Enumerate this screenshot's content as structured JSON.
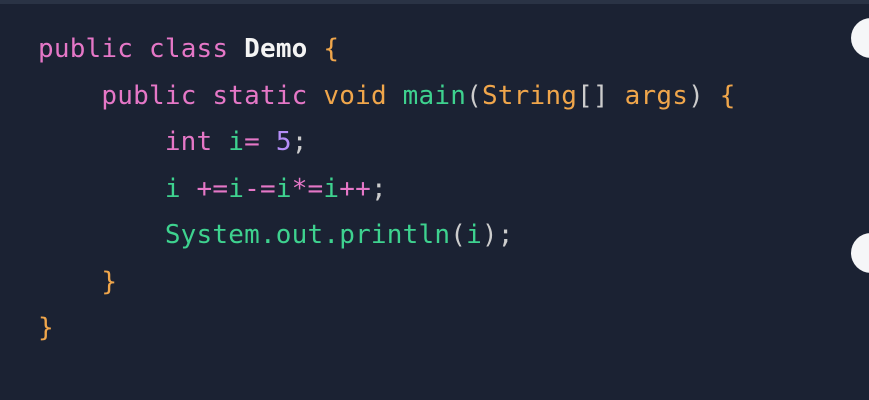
{
  "code": {
    "lines": [
      {
        "tokens": [
          {
            "text": "public",
            "kind": "keyword"
          },
          {
            "text": " ",
            "kind": "space"
          },
          {
            "text": "class",
            "kind": "keyword"
          },
          {
            "text": " ",
            "kind": "space"
          },
          {
            "text": "Demo",
            "kind": "classname"
          },
          {
            "text": " ",
            "kind": "space"
          },
          {
            "text": "{",
            "kind": "brace"
          }
        ]
      },
      {
        "tokens": [
          {
            "text": "    ",
            "kind": "space"
          },
          {
            "text": "public",
            "kind": "keyword"
          },
          {
            "text": " ",
            "kind": "space"
          },
          {
            "text": "static",
            "kind": "keyword"
          },
          {
            "text": " ",
            "kind": "space"
          },
          {
            "text": "void",
            "kind": "type"
          },
          {
            "text": " ",
            "kind": "space"
          },
          {
            "text": "main",
            "kind": "method"
          },
          {
            "text": "(",
            "kind": "paren"
          },
          {
            "text": "String",
            "kind": "type"
          },
          {
            "text": "[]",
            "kind": "paren"
          },
          {
            "text": " ",
            "kind": "space"
          },
          {
            "text": "args",
            "kind": "ident"
          },
          {
            "text": ")",
            "kind": "paren"
          },
          {
            "text": " ",
            "kind": "space"
          },
          {
            "text": "{",
            "kind": "brace"
          }
        ]
      },
      {
        "tokens": [
          {
            "text": "        ",
            "kind": "space"
          },
          {
            "text": "int",
            "kind": "keyword"
          },
          {
            "text": " ",
            "kind": "space"
          },
          {
            "text": "i",
            "kind": "var"
          },
          {
            "text": "=",
            "kind": "op"
          },
          {
            "text": " ",
            "kind": "space"
          },
          {
            "text": "5",
            "kind": "number"
          },
          {
            "text": ";",
            "kind": "punct"
          }
        ]
      },
      {
        "tokens": [
          {
            "text": "        ",
            "kind": "space"
          },
          {
            "text": "i",
            "kind": "var"
          },
          {
            "text": " ",
            "kind": "space"
          },
          {
            "text": "+=",
            "kind": "op"
          },
          {
            "text": "i",
            "kind": "var"
          },
          {
            "text": "-=",
            "kind": "op"
          },
          {
            "text": "i",
            "kind": "var"
          },
          {
            "text": "*=",
            "kind": "op"
          },
          {
            "text": "i",
            "kind": "var"
          },
          {
            "text": "++",
            "kind": "op"
          },
          {
            "text": ";",
            "kind": "punct"
          }
        ]
      },
      {
        "tokens": [
          {
            "text": "        ",
            "kind": "space"
          },
          {
            "text": "System.out.println",
            "kind": "plain"
          },
          {
            "text": "(",
            "kind": "paren"
          },
          {
            "text": "i",
            "kind": "var"
          },
          {
            "text": ");",
            "kind": "punct"
          }
        ]
      },
      {
        "tokens": [
          {
            "text": "    ",
            "kind": "space"
          },
          {
            "text": "}",
            "kind": "brace"
          }
        ]
      },
      {
        "tokens": [
          {
            "text": "}",
            "kind": "brace"
          }
        ]
      }
    ]
  },
  "colors": {
    "background": "#1b2233",
    "keyword": "#e577c7",
    "type": "#f0a64b",
    "method": "#3ed28f",
    "number": "#b58df7",
    "classname": "#f4f4f4"
  }
}
